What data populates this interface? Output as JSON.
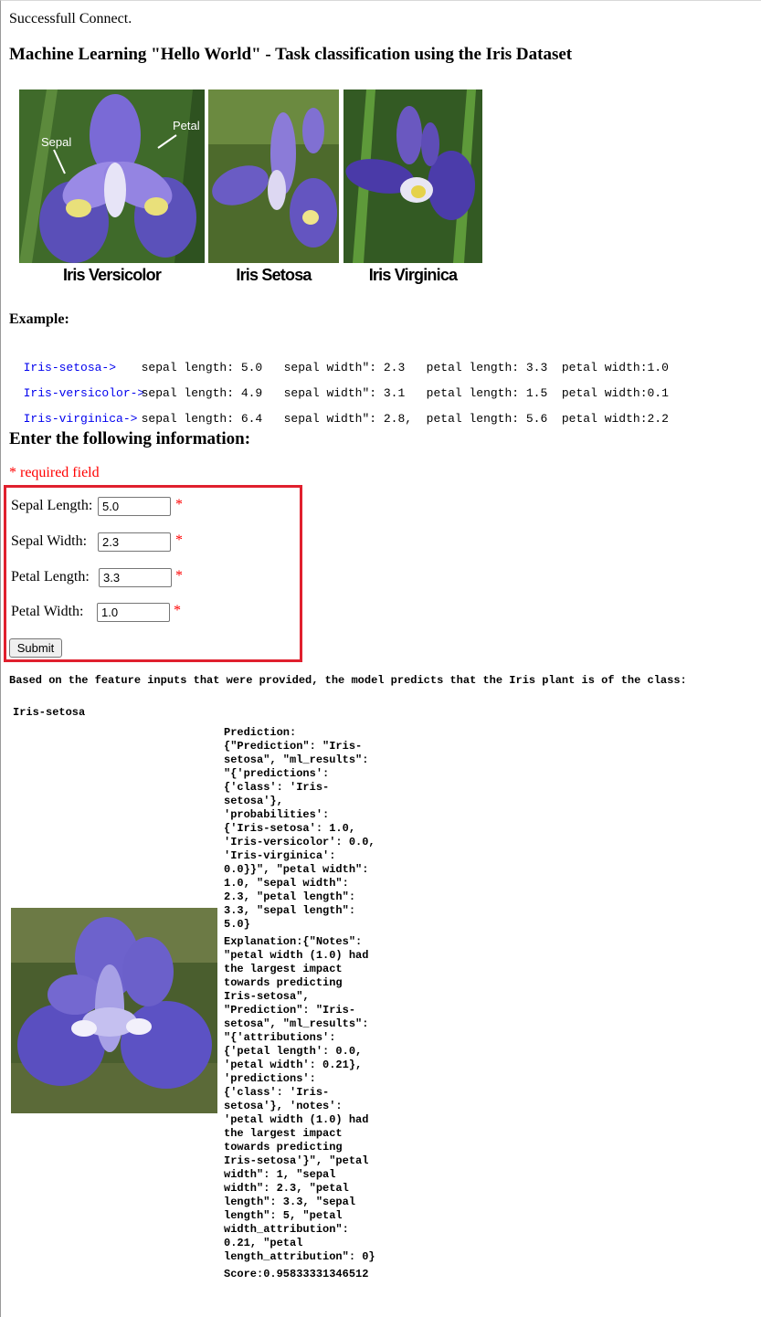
{
  "status": "Successfull Connect.",
  "title": "Machine Learning \"Hello World\" - Task classification using the Iris Dataset",
  "banner": {
    "captions": [
      "Iris Versicolor",
      "Iris Setosa",
      "Iris Virginica"
    ],
    "labels": {
      "sepal": "Sepal",
      "petal": "Petal"
    }
  },
  "example": {
    "heading": "Example:",
    "rows": [
      {
        "link": "Iris-setosa->",
        "values": "sepal length: 5.0   sepal width\": 2.3   petal length: 3.3  petal width:1.0"
      },
      {
        "link": "Iris-versicolor->",
        "values": "sepal length: 4.9   sepal width\": 3.1   petal length: 1.5  petal width:0.1"
      },
      {
        "link": "Iris-virginica->",
        "values": "sepal length: 6.4   sepal width\": 2.8,  petal length: 5.6  petal width:2.2"
      }
    ]
  },
  "form": {
    "heading": "Enter the following information:",
    "required_note": "* required field",
    "star": "*",
    "fields": [
      {
        "label": "Sepal Length:",
        "value": "5.0"
      },
      {
        "label": "Sepal Width:",
        "value": "2.3"
      },
      {
        "label": "Petal Length:",
        "value": "3.3"
      },
      {
        "label": "Petal Width:",
        "value": "1.0"
      }
    ],
    "submit": "Submit"
  },
  "result": {
    "intro": "Based on the feature inputs that were provided, the model predicts that the Iris plant is of the class:",
    "predicted_class": "Iris-setosa",
    "prediction_text": "Prediction: {\"Prediction\": \"Iris-setosa\", \"ml_results\": \"{'predictions': {'class': 'Iris-setosa'}, 'probabilities': {'Iris-setosa': 1.0, 'Iris-versicolor': 0.0, 'Iris-virginica': 0.0}}\", \"petal width\": 1.0, \"sepal width\": 2.3, \"petal length\": 3.3, \"sepal length\": 5.0}",
    "explanation_text": "Explanation:{\"Notes\": \"petal width (1.0) had the largest impact towards predicting Iris-setosa\", \"Prediction\": \"Iris-setosa\", \"ml_results\": \"{'attributions': {'petal length': 0.0, 'petal width': 0.21}, 'predictions': {'class': 'Iris-setosa'}, 'notes': 'petal width (1.0) had the largest impact towards predicting Iris-setosa'}\", \"petal width\": 1, \"sepal width\": 2.3, \"petal length\": 3.3, \"sepal length\": 5, \"petal width_attribution\": 0.21, \"petal length_attribution\": 0}",
    "score_text": "Score:0.95833331346512"
  }
}
